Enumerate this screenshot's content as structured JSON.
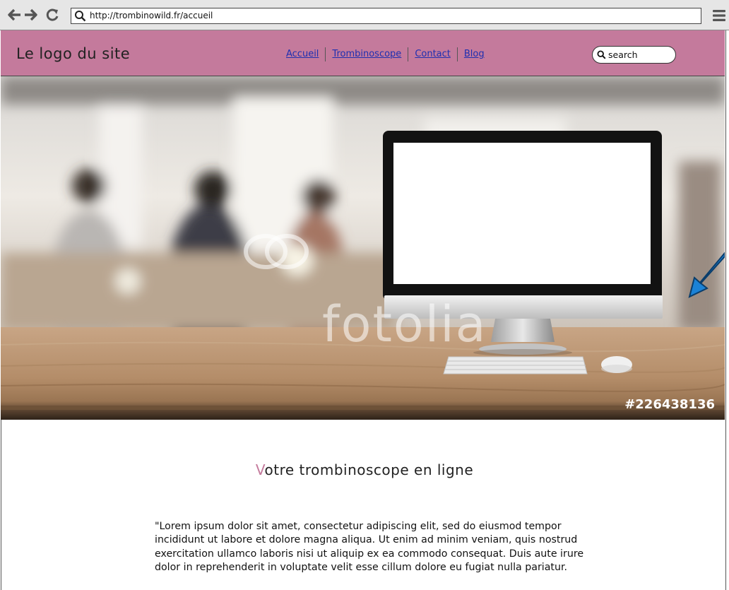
{
  "browser": {
    "url": "http://trombinowild.fr/accueil"
  },
  "header": {
    "logo": "Le logo du site",
    "nav": [
      "Accueil",
      "Trombinoscope",
      "Contact",
      "Blog"
    ],
    "search_placeholder": "search"
  },
  "hero": {
    "watermark": "fotolia",
    "photo_id": "#226438136"
  },
  "content": {
    "headline_first": "V",
    "headline_rest": "otre trombinoscope en ligne",
    "paragraph": "\"Lorem ipsum dolor sit amet, consectetur adipiscing elit, sed do eiusmod tempor incididunt ut labore et dolore magna aliqua. Ut enim ad minim veniam, quis nostrud exercitation ullamco laboris nisi ut aliquip ex ea commodo consequat. Duis aute irure dolor in reprehenderit in voluptate velit esse cillum dolore eu fugiat nulla pariatur."
  },
  "colors": {
    "header_bg": "#c47a9c",
    "accent": "#c47a9c",
    "link": "#1f2fb0"
  }
}
